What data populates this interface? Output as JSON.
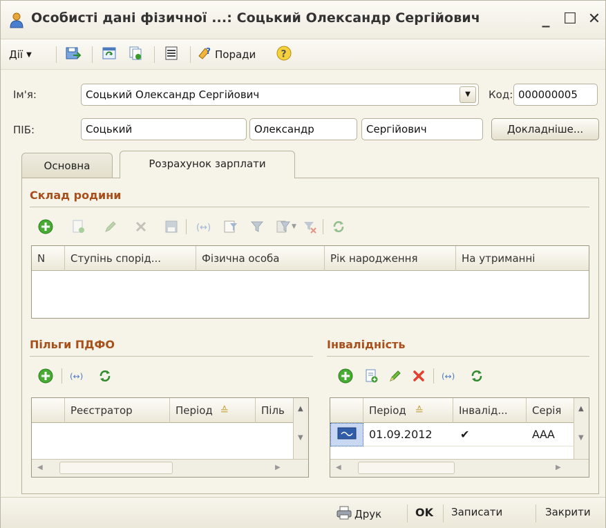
{
  "window": {
    "title": "Особисті дані фізичної ...: Соцький Олександр Сергійович",
    "minimize": "_",
    "maximize": "☐",
    "close": "✕"
  },
  "toolbar": {
    "actions_label": "Дії",
    "hints_label": "Поради"
  },
  "form": {
    "name_label": "Ім'я:",
    "name_value": "Соцький Олександр Сергійович",
    "code_label": "Код:",
    "code_value": "000000005",
    "pib_label": "ПІБ:",
    "surname": "Соцький",
    "firstname": "Олександр",
    "patronymic": "Сергійович",
    "details_button": "Докладніше..."
  },
  "tabs": [
    {
      "label": "Основна",
      "active": false
    },
    {
      "label": "Розрахунок зарплати",
      "active": true
    }
  ],
  "family": {
    "title": "Склад родини",
    "columns": [
      "N",
      "Ступінь спорід...",
      "Фізична особа",
      "Рік народження",
      "На утриманні"
    ]
  },
  "benefits": {
    "title": "Пільги ПДФО",
    "columns": [
      "",
      "Реєстратор",
      "Період",
      "Піль"
    ]
  },
  "disability": {
    "title": "Інвалідність",
    "columns": [
      "",
      "Період",
      "Інвалід...",
      "Серія"
    ],
    "rows": [
      {
        "period": "01.09.2012",
        "invalid": "✔",
        "series": "ААА"
      }
    ]
  },
  "bottom": {
    "print_label": "Друк",
    "ok_label": "OK",
    "save_label": "Записати",
    "close_label": "Закрити"
  },
  "colors": {
    "section_title": "#a8501c",
    "add_green": "#3a9a2c",
    "delete_red": "#d23a2a",
    "selected_row": "#dfe8f8"
  }
}
